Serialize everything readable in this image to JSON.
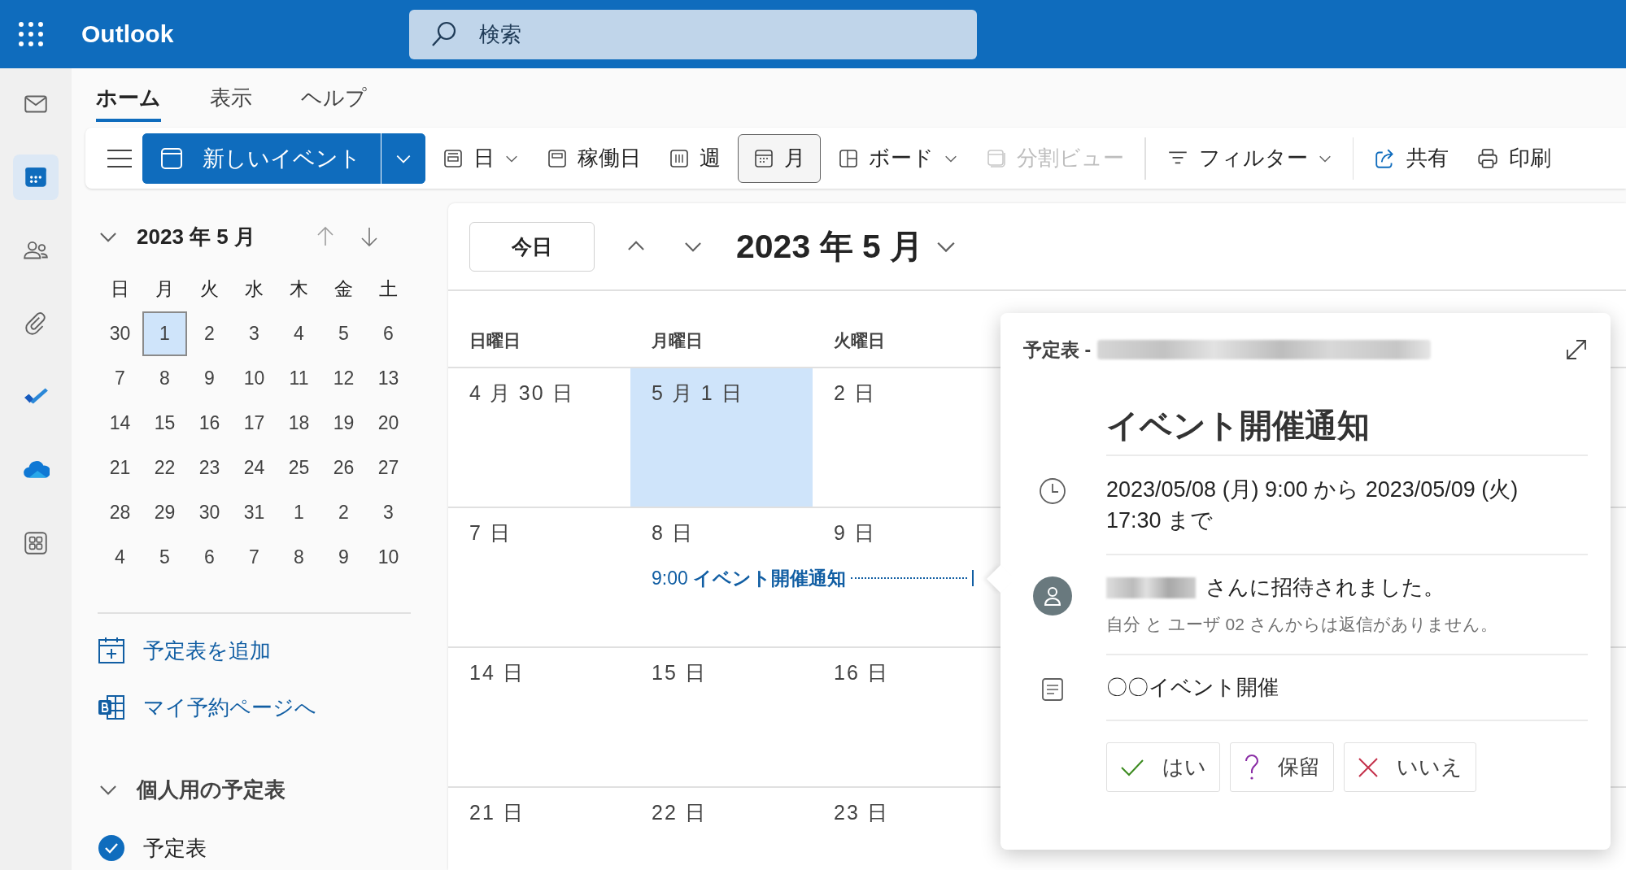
{
  "top_bar": {
    "app_name": "Outlook",
    "search": {
      "placeholder": "検索"
    }
  },
  "app_rail": [
    {
      "selected": false
    },
    {
      "selected": true
    },
    {
      "selected": false
    },
    {
      "selected": false
    },
    {
      "selected": false
    },
    {
      "selected": false
    },
    {
      "selected": false
    }
  ],
  "tabs": [
    {
      "label": "ホーム",
      "selected": true
    },
    {
      "label": "表示",
      "selected": false
    },
    {
      "label": "ヘルプ",
      "selected": false
    }
  ],
  "ribbon": {
    "new_event": {
      "label": "新しいイベント"
    },
    "views": [
      {
        "label": "日",
        "selected": false,
        "disabled": false,
        "dropdown": true
      },
      {
        "label": "稼働日",
        "selected": false,
        "disabled": false,
        "dropdown": false
      },
      {
        "label": "週",
        "selected": false,
        "disabled": false,
        "dropdown": false
      },
      {
        "label": "月",
        "selected": true,
        "disabled": false,
        "dropdown": false
      },
      {
        "label": "ボード",
        "selected": false,
        "disabled": false,
        "dropdown": true
      },
      {
        "label": "分割ビュー",
        "selected": false,
        "disabled": true,
        "dropdown": false
      }
    ],
    "actions": [
      {
        "label": "フィルター",
        "dropdown": true
      },
      {
        "label": "共有",
        "dropdown": false
      },
      {
        "label": "印刷",
        "dropdown": false
      }
    ]
  },
  "mini_calendar": {
    "title": "2023 年 5 月",
    "weekdays": [
      "日",
      "月",
      "火",
      "水",
      "木",
      "金",
      "土"
    ],
    "weeks": [
      [
        {
          "day": "30",
          "selected": false
        },
        {
          "day": "1",
          "selected": true
        },
        {
          "day": "2",
          "selected": false
        },
        {
          "day": "3",
          "selected": false
        },
        {
          "day": "4",
          "selected": false
        },
        {
          "day": "5",
          "selected": false
        },
        {
          "day": "6",
          "selected": false
        }
      ],
      [
        {
          "day": "7",
          "selected": false
        },
        {
          "day": "8",
          "selected": false
        },
        {
          "day": "9",
          "selected": false
        },
        {
          "day": "10",
          "selected": false
        },
        {
          "day": "11",
          "selected": false
        },
        {
          "day": "12",
          "selected": false
        },
        {
          "day": "13",
          "selected": false
        }
      ],
      [
        {
          "day": "14",
          "selected": false
        },
        {
          "day": "15",
          "selected": false
        },
        {
          "day": "16",
          "selected": false
        },
        {
          "day": "17",
          "selected": false
        },
        {
          "day": "18",
          "selected": false
        },
        {
          "day": "19",
          "selected": false
        },
        {
          "day": "20",
          "selected": false
        }
      ],
      [
        {
          "day": "21",
          "selected": false
        },
        {
          "day": "22",
          "selected": false
        },
        {
          "day": "23",
          "selected": false
        },
        {
          "day": "24",
          "selected": false
        },
        {
          "day": "25",
          "selected": false
        },
        {
          "day": "26",
          "selected": false
        },
        {
          "day": "27",
          "selected": false
        }
      ],
      [
        {
          "day": "28",
          "selected": false
        },
        {
          "day": "29",
          "selected": false
        },
        {
          "day": "30",
          "selected": false
        },
        {
          "day": "31",
          "selected": false
        },
        {
          "day": "1",
          "selected": false
        },
        {
          "day": "2",
          "selected": false
        },
        {
          "day": "3",
          "selected": false
        }
      ],
      [
        {
          "day": "4",
          "selected": false
        },
        {
          "day": "5",
          "selected": false
        },
        {
          "day": "6",
          "selected": false
        },
        {
          "day": "7",
          "selected": false
        },
        {
          "day": "8",
          "selected": false
        },
        {
          "day": "9",
          "selected": false
        },
        {
          "day": "10",
          "selected": false
        }
      ]
    ]
  },
  "links": [
    {
      "label": "予定表を追加"
    },
    {
      "label": "マイ予約ページへ"
    }
  ],
  "calendar_group": {
    "title": "個人用の予定表",
    "expanded": true,
    "calendars": [
      {
        "name": "予定表",
        "checked": true
      }
    ]
  },
  "calendar": {
    "today_button": "今日",
    "title": "2023 年 5 月",
    "weekdays": [
      "日曜日",
      "月曜日",
      "火曜日"
    ],
    "weeks": [
      {
        "days": [
          {
            "label": "4 月 30 日",
            "selected": false
          },
          {
            "label": "5 月 1 日",
            "selected": true
          },
          {
            "label": "2 日",
            "selected": false
          }
        ]
      },
      {
        "days": [
          {
            "label": "7 日",
            "selected": false
          },
          {
            "label": "8 日",
            "selected": false,
            "event": {
              "text": "9:00 **イベント開催通知**",
              "multi_day": true
            }
          },
          {
            "label": "9 日",
            "selected": false
          }
        ]
      },
      {
        "days": [
          {
            "label": "14 日",
            "selected": false
          },
          {
            "label": "15 日",
            "selected": false
          },
          {
            "label": "16 日",
            "selected": false
          }
        ]
      },
      {
        "days": [
          {
            "label": "21 日",
            "selected": false
          },
          {
            "label": "22 日",
            "selected": false
          },
          {
            "label": "23 日",
            "selected": false
          }
        ]
      }
    ]
  },
  "event_popup": {
    "calendar_label": "予定表 -",
    "title": "イベント開催通知",
    "time": "2023/05/08 (月) 9:00 から 2023/05/09 (火) 17:30 まで",
    "invite": "さんに招待されました。",
    "response_note": "自分 と ユーザ 02 さんからは返信がありません。",
    "description": "〇〇イベント開催",
    "responses": [
      {
        "label": "はい",
        "kind": "accept"
      },
      {
        "label": "保留",
        "kind": "tentative"
      },
      {
        "label": "いいえ",
        "kind": "decline"
      }
    ]
  }
}
